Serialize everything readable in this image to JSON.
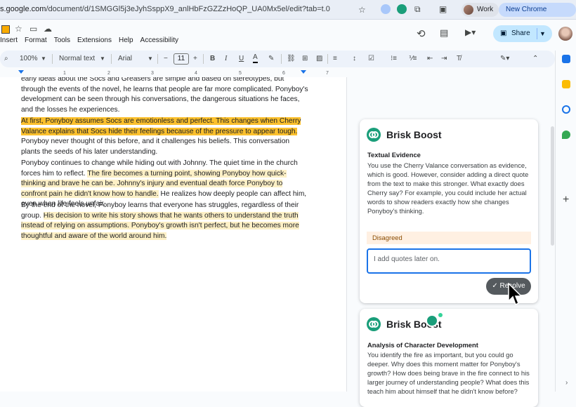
{
  "browser": {
    "url_host": "s.google.com",
    "url_path": "/document/d/1SMGGl5j3eJyhSsppX9_anlHbFzGZZzHoQP_UA0Mx5el/edit?tab=t.0",
    "profile_label": "Work",
    "update_label": "New Chrome available"
  },
  "docs": {
    "menu": [
      "Insert",
      "Format",
      "Tools",
      "Extensions",
      "Help",
      "Accessibility"
    ],
    "share_label": "Share"
  },
  "toolbar": {
    "zoom": "100%",
    "style": "Normal text",
    "font": "Arial",
    "font_size": "11"
  },
  "ruler": {
    "ticks": [
      "1",
      "2",
      "3",
      "4",
      "5",
      "6",
      "7"
    ]
  },
  "document": {
    "p1": "early ideas about the Socs and Greasers are simple and based on stereotypes, but through the events of the novel, he learns that people are far more complicated. Ponyboy's development can be seen through his conversations, the dangerous situations he faces, and the losses he experiences.",
    "p2_highlight": "At first, Ponyboy assumes Socs are emotionless and perfect. This changes when Cherry Valance explains that Socs hide their feelings because of the pressure to appear tough.",
    "p2_rest": " Ponyboy never thought of this before, and it challenges his beliefs. This conversation plants the seeds of his later understanding.",
    "p3_plain": "Ponyboy continues to change while hiding out with Johnny. The quiet time in the church forces him to reflect. ",
    "p3_highlight": "The fire becomes a turning point, showing Ponyboy how quick-thinking and brave he can be. Johnny's injury and eventual death force Ponyboy to confront pain he didn't know how to handle.",
    "p3_rest": " He realizes how deeply people can affect him, even when life feels unfair.",
    "p4_plain": "By the end of the novel, Ponyboy learns that everyone has struggles, regardless of their group. ",
    "p4_highlight": "His decision to write his story shows that he wants others to understand the truth instead of relying on assumptions. Ponyboy's growth isn't perfect, but he becomes more thoughtful and aware of the world around him."
  },
  "cards": [
    {
      "title": "Brisk Boost",
      "subtitle": "Textual Evidence",
      "body": "You use the Cherry Valance conversation as evidence, which is good. However, consider adding a direct quote from the text to make this stronger. What exactly does Cherry say? For example, you could include her actual words to show readers exactly how she changes Ponyboy's thinking.",
      "status": "Disagreed",
      "reply": "I add quotes later on.",
      "resolve_label": "Resolve"
    },
    {
      "title": "Brisk Boost",
      "subtitle": "Analysis of Character Development",
      "body": "You identify the fire as important, but you could go deeper. Why does this moment matter for Ponyboy's growth? How does being brave in the fire connect to his larger journey of understanding people? What does this teach him about himself that he didn't know before?"
    }
  ],
  "colors": {
    "highlight_active": "#fbc02d",
    "highlight_soft": "#fdf0c6",
    "brisk_green": "#1a9e7a",
    "accent_blue": "#1a73e8"
  }
}
